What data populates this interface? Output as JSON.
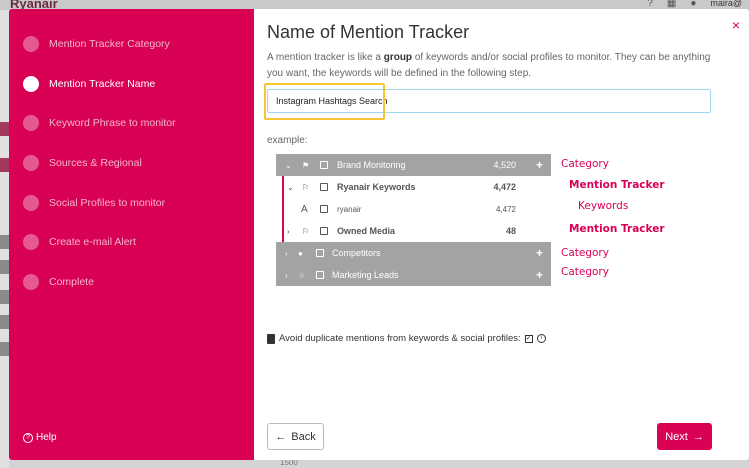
{
  "background": {
    "brand": "Ryanair",
    "user": "maira@",
    "tick": "1500"
  },
  "sidebar": {
    "steps": [
      {
        "label": "Mention Tracker Category",
        "active": false
      },
      {
        "label": "Mention Tracker Name",
        "active": true
      },
      {
        "label": "Keyword Phrase to monitor",
        "active": false
      },
      {
        "label": "Sources & Regional",
        "active": false
      },
      {
        "label": "Social Profiles to monitor",
        "active": false
      },
      {
        "label": "Create e-mail Alert",
        "active": false
      },
      {
        "label": "Complete",
        "active": false
      }
    ],
    "help_label": "Help"
  },
  "content": {
    "close_glyph": "×",
    "title": "Name of Mention Tracker",
    "desc_before": "A mention tracker is like a ",
    "desc_bold": "group",
    "desc_after": " of keywords and/or social profiles to monitor. They can be anything you want, the keywords will be defined in the following step.",
    "name_input_value": "Instagram Hashtags Search",
    "example_label": "example:",
    "tree": [
      {
        "label": "Brand Monitoring",
        "count": "4,520"
      },
      {
        "label": "Ryanair Keywords",
        "count": "4,472"
      },
      {
        "label": "ryanair",
        "count": "4,472"
      },
      {
        "label": "Owned Media",
        "count": "48"
      },
      {
        "label": "Competitors",
        "count": ""
      },
      {
        "label": "Marketing Leads",
        "count": ""
      }
    ],
    "annotations": {
      "category1": "Category",
      "tracker1": "Mention Tracker",
      "keywords": "Keywords",
      "tracker2": "Mention Tracker",
      "category2": "Category",
      "category3": "Category"
    },
    "dup_label": "Avoid duplicate mentions from keywords & social profiles:",
    "back_label": "Back",
    "next_label": "Next"
  },
  "colors": {
    "accent": "#d90155",
    "highlight": "#f7c531",
    "input_border": "#9fd6f0",
    "tree_dark": "#a3a3a3"
  }
}
